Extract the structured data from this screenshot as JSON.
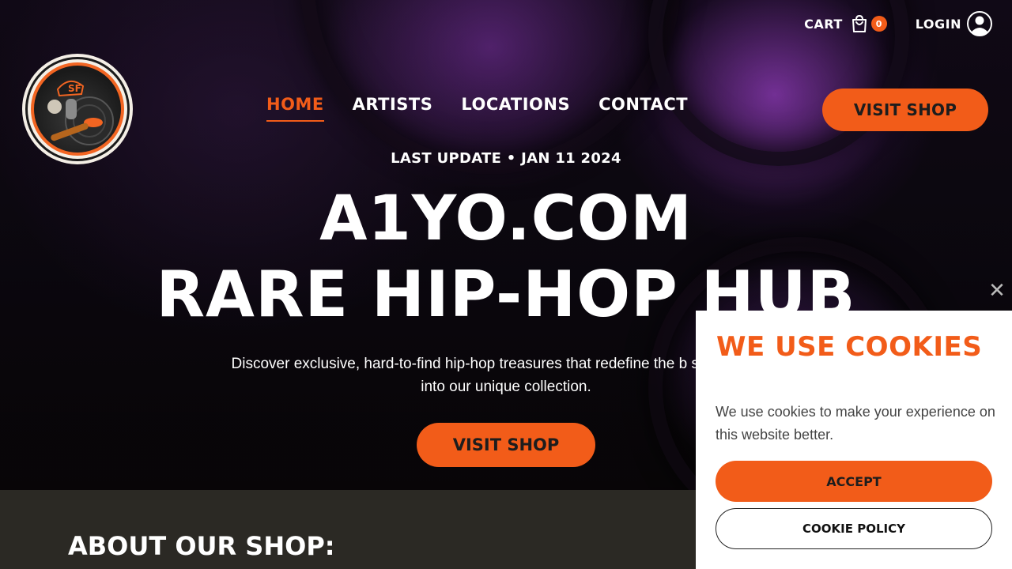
{
  "header": {
    "cart_label": "CART",
    "cart_count": "0",
    "login_label": "LOGIN",
    "visit_shop_label": "VISIT SHOP",
    "logo_icon": "hip-hop-turntable-logo-icon"
  },
  "nav": {
    "items": [
      {
        "label": "HOME",
        "active": true
      },
      {
        "label": "ARTISTS",
        "active": false
      },
      {
        "label": "LOCATIONS",
        "active": false
      },
      {
        "label": "CONTACT",
        "active": false
      }
    ]
  },
  "hero": {
    "update_line": "LAST UPDATE • JAN 11 2024",
    "headline_1": "A1YO.COM",
    "headline_2": "RARE HIP-HOP HUB",
    "subtext": "Discover exclusive, hard-to-find hip-hop treasures that redefine the b streets – dive into our unique collection.",
    "cta_label": "VISIT SHOP"
  },
  "about": {
    "title": "ABOUT OUR SHOP:"
  },
  "cookie_banner": {
    "title": "WE USE COOKIES",
    "text": "We use cookies to make your experience on this website better.",
    "accept_label": "ACCEPT",
    "policy_label": "COOKIE POLICY",
    "close_icon": "close-icon"
  },
  "colors": {
    "accent": "#f25c19",
    "dark": "#2b2924",
    "banner_bg": "#ffffff"
  }
}
